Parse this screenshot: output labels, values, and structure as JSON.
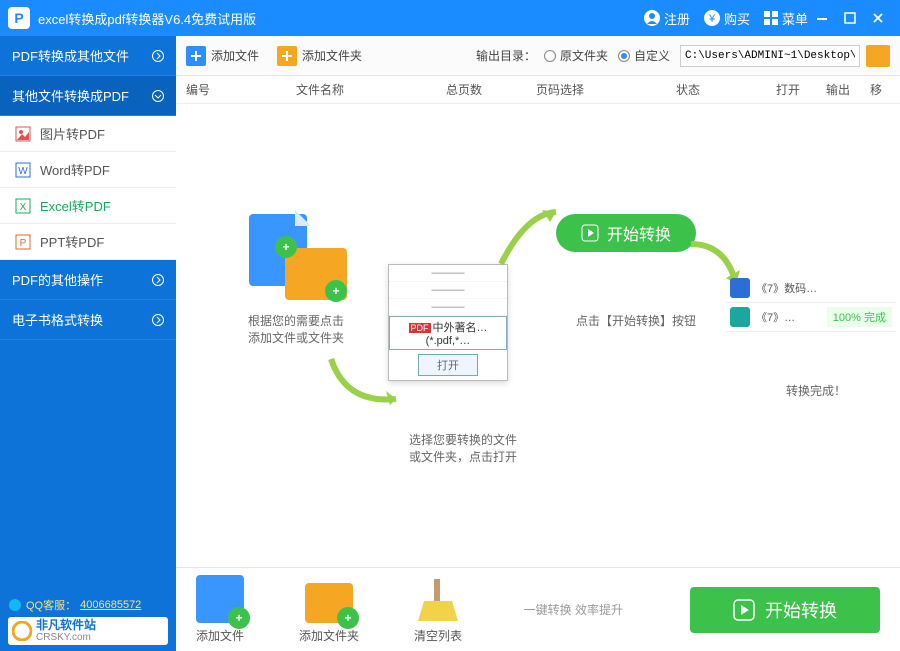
{
  "titlebar": {
    "app_logo_letter": "P",
    "title": "excel转换成pdf转换器V6.4免费试用版",
    "register": "注册",
    "purchase": "购买",
    "menu": "菜单"
  },
  "sidebar": {
    "categories": [
      {
        "label": "PDF转换成其他文件"
      },
      {
        "label": "其他文件转换成PDF"
      },
      {
        "label": "PDF的其他操作"
      },
      {
        "label": "电子书格式转换"
      }
    ],
    "subitems": [
      {
        "label": "图片转PDF",
        "icon_color": "#e05252"
      },
      {
        "label": "Word转PDF",
        "icon_color": "#2b6fd6"
      },
      {
        "label": "Excel转PDF",
        "icon_color": "#1aa760"
      },
      {
        "label": "PPT转PDF",
        "icon_color": "#e06a2b"
      }
    ],
    "qq_label": "QQ客服：",
    "qq_number": "4006685572",
    "brand_cn": "非凡软件站",
    "brand_en": "CRSKY.com"
  },
  "toolbar": {
    "add_file": "添加文件",
    "add_folder": "添加文件夹",
    "output_label": "输出目录：",
    "radio_original": "原文件夹",
    "radio_custom": "自定义",
    "path_value": "C:\\Users\\ADMINI~1\\Desktop\\"
  },
  "headers": {
    "seq": "编号",
    "filename": "文件名称",
    "pages": "总页数",
    "page_select": "页码选择",
    "status": "状态",
    "open": "打开",
    "output": "输出",
    "move": "移"
  },
  "guide": {
    "step1": "根据您的需要点击\n添加文件或文件夹",
    "step2_filter": "中外著名… (*.pdf,*…",
    "step2_open": "打开",
    "step2_caption": "选择您要转换的文件\n或文件夹，点击打开",
    "step3_btn": "开始转换",
    "step3_caption": "点击【开始转换】按钮",
    "step4_row1": "《7》数码…",
    "step4_row2": "《7》…",
    "step4_done": "100% 完成",
    "step4_caption": "转换完成！"
  },
  "bottom": {
    "add_file": "添加文件",
    "add_folder": "添加文件夹",
    "clear": "清空列表",
    "tagline": "一键转换  效率提升",
    "start": "开始转换"
  }
}
